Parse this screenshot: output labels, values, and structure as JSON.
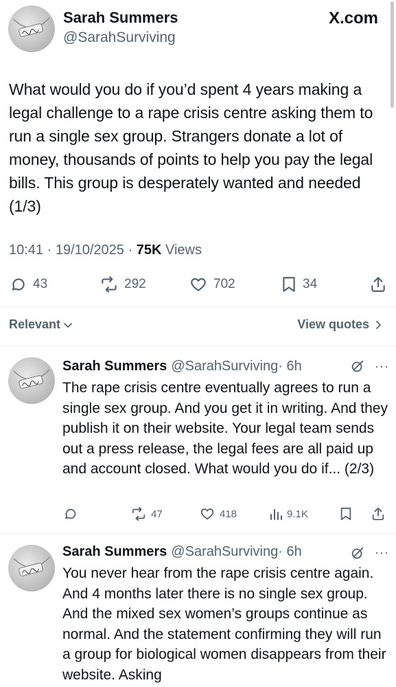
{
  "brand": "X.com",
  "main_post": {
    "author_name": "Sarah Summers",
    "author_handle": "@SarahSurviving",
    "avatar_icon": "necklace-avatar-icon",
    "text": "What would you do if you’d spent 4 years making a legal challenge to a rape crisis centre asking them to run a single sex group. Strangers donate a lot of money, thousands of points to help you pay the legal bills. This group is desperately wanted and needed (1/3)",
    "time": "10:41 · 19/10/2025 · ",
    "views_count": "75K",
    "views_label": " Views",
    "replies": "43",
    "reposts": "292",
    "likes": "702",
    "bookmarks": "34"
  },
  "sort": {
    "label": "Relevant",
    "view_quotes": "View quotes"
  },
  "replies": [
    {
      "author_name": "Sarah Summers",
      "author_handle": "@SarahSurviving",
      "time": " · 6h",
      "text": "The rape crisis centre eventually agrees to run a single sex group. And you get it in writing. And they publish it on their website. Your legal team sends out a press release, the legal fees are all paid up and account closed. What would you do if...  (2/3)",
      "reposts": "47",
      "likes": "418",
      "views": "9.1K"
    },
    {
      "author_name": "Sarah Summers",
      "author_handle": "@SarahSurviving",
      "time": " · 6h",
      "text": "You never hear from the rape crisis centre again. And 4 months later there is no single sex group. And the mixed sex women’s groups continue as normal. And the statement confirming they will run a group for biological women disappears from their website. Asking"
    }
  ],
  "more_glyph": "···",
  "colors": {
    "text": "#0f1419",
    "secondary": "#536471",
    "divider": "#eff3f4"
  }
}
